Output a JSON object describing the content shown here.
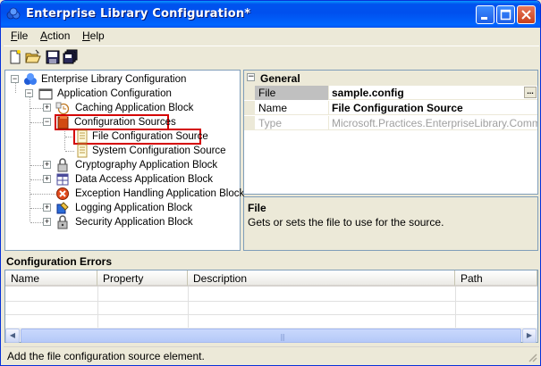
{
  "window": {
    "title": "Enterprise Library Configuration*"
  },
  "menu": {
    "items": [
      {
        "prefix": "",
        "hotkey": "F",
        "rest": "ile"
      },
      {
        "prefix": "",
        "hotkey": "A",
        "rest": "ction"
      },
      {
        "prefix": "",
        "hotkey": "H",
        "rest": "elp"
      }
    ]
  },
  "toolbar": {
    "icons": [
      "new-icon",
      "open-folder-icon",
      "save-icon",
      "save-all-icon"
    ]
  },
  "tree": {
    "nodes": [
      {
        "label": "Enterprise Library Configuration",
        "icon": "enterprise-library-icon",
        "expanded": true
      },
      {
        "label": "Application Configuration",
        "icon": "application-window-icon",
        "expanded": true
      },
      {
        "label": "Caching Application Block",
        "icon": "caching-block-icon",
        "expanded": false
      },
      {
        "label": "Configuration Sources",
        "icon": "configuration-sources-icon",
        "expanded": true
      },
      {
        "label": "File Configuration Source",
        "icon": "file-source-icon"
      },
      {
        "label": "System Configuration Source",
        "icon": "system-source-icon"
      },
      {
        "label": "Cryptography Application Block",
        "icon": "cryptography-block-icon",
        "expanded": false
      },
      {
        "label": "Data Access Application Block",
        "icon": "data-access-block-icon",
        "expanded": false
      },
      {
        "label": "Exception Handling Application Block",
        "icon": "exception-block-icon"
      },
      {
        "label": "Logging Application Block",
        "icon": "logging-block-icon",
        "expanded": false
      },
      {
        "label": "Security Application Block",
        "icon": "security-block-icon",
        "expanded": false
      }
    ]
  },
  "properties": {
    "category": "General",
    "rows": [
      {
        "name": "File",
        "value": "sample.config",
        "button": "..."
      },
      {
        "name": "Name",
        "value": "File Configuration Source"
      },
      {
        "name": "Type",
        "value": "Microsoft.Practices.EnterpriseLibrary.Common.Co"
      }
    ]
  },
  "description": {
    "title": "File",
    "text": "Gets or sets the file to use for the source."
  },
  "errors": {
    "label": "Configuration Errors",
    "columns": [
      "Name",
      "Property",
      "Description",
      "Path"
    ]
  },
  "status": {
    "text": "Add the file configuration source element."
  },
  "colors": {
    "titlebar": "#0053ee",
    "highlight_border": "#d40000"
  }
}
